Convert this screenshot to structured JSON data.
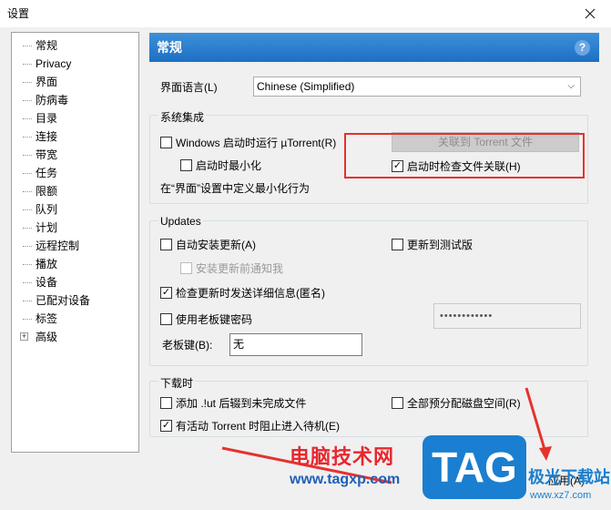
{
  "window": {
    "title": "设置"
  },
  "tree": {
    "items": [
      {
        "label": "常规"
      },
      {
        "label": "Privacy"
      },
      {
        "label": "界面"
      },
      {
        "label": "防病毒"
      },
      {
        "label": "目录"
      },
      {
        "label": "连接"
      },
      {
        "label": "带宽"
      },
      {
        "label": "任务"
      },
      {
        "label": "限额"
      },
      {
        "label": "队列"
      },
      {
        "label": "计划"
      },
      {
        "label": "远程控制"
      },
      {
        "label": "播放"
      },
      {
        "label": "设备"
      },
      {
        "label": "已配对设备"
      },
      {
        "label": "标签"
      },
      {
        "label": "高级",
        "toggle": "+"
      }
    ]
  },
  "panel": {
    "header": "常规",
    "help_icon": "?",
    "language": {
      "label": "界面语言(L)",
      "value": "Chinese (Simplified)"
    },
    "system": {
      "title": "系统集成",
      "start_with_windows": "Windows 启动时运行 µTorrent(R)",
      "start_minimized": "启动时最小化",
      "associate_button": "关联到 Torrent 文件",
      "check_association": "启动时检查文件关联(H)",
      "minimize_hint": "在“界面”设置中定义最小化行为"
    },
    "updates": {
      "title": "Updates",
      "auto_install": "自动安装更新(A)",
      "beta": "更新到测试版",
      "notify_before": "安装更新前通知我",
      "send_info": "检查更新时发送详细信息(匿名)",
      "boss_key_password": "使用老板键密码",
      "password_value": "••••••••••••",
      "boss_key_label": "老板键(B):",
      "boss_key_value": "无"
    },
    "downloads": {
      "title": "下载时",
      "add_ut": "添加 .!ut 后辍到未完成文件",
      "preallocate": "全部预分配磁盘空间(R)",
      "prevent_standby": "有活动 Torrent 时阻止进入待机(E)"
    }
  },
  "footer": {
    "apply": "应用(A)"
  },
  "watermark": {
    "brand": "电脑技术网",
    "url": "www.tagxp.com",
    "tag": "TAG",
    "site": "极光下载站",
    "site_url": "www.xz7.com"
  },
  "colors": {
    "header": "#1d6fc4",
    "highlight": "#e5322d",
    "arrow": "#e5322d"
  }
}
